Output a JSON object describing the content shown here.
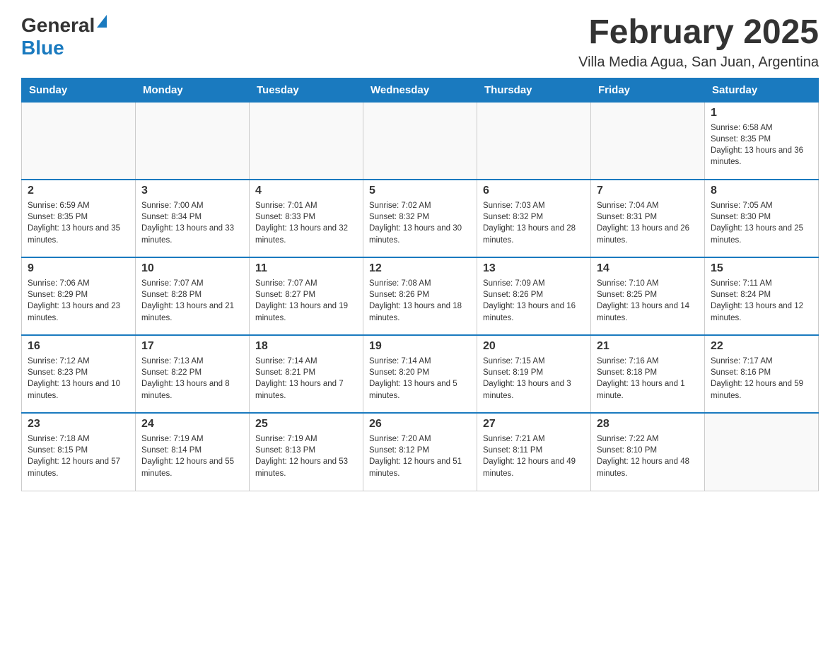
{
  "header": {
    "logo_general": "General",
    "logo_blue": "Blue",
    "month_title": "February 2025",
    "location": "Villa Media Agua, San Juan, Argentina"
  },
  "weekdays": [
    "Sunday",
    "Monday",
    "Tuesday",
    "Wednesday",
    "Thursday",
    "Friday",
    "Saturday"
  ],
  "weeks": [
    [
      {
        "day": "",
        "sunrise": "",
        "sunset": "",
        "daylight": ""
      },
      {
        "day": "",
        "sunrise": "",
        "sunset": "",
        "daylight": ""
      },
      {
        "day": "",
        "sunrise": "",
        "sunset": "",
        "daylight": ""
      },
      {
        "day": "",
        "sunrise": "",
        "sunset": "",
        "daylight": ""
      },
      {
        "day": "",
        "sunrise": "",
        "sunset": "",
        "daylight": ""
      },
      {
        "day": "",
        "sunrise": "",
        "sunset": "",
        "daylight": ""
      },
      {
        "day": "1",
        "sunrise": "Sunrise: 6:58 AM",
        "sunset": "Sunset: 8:35 PM",
        "daylight": "Daylight: 13 hours and 36 minutes."
      }
    ],
    [
      {
        "day": "2",
        "sunrise": "Sunrise: 6:59 AM",
        "sunset": "Sunset: 8:35 PM",
        "daylight": "Daylight: 13 hours and 35 minutes."
      },
      {
        "day": "3",
        "sunrise": "Sunrise: 7:00 AM",
        "sunset": "Sunset: 8:34 PM",
        "daylight": "Daylight: 13 hours and 33 minutes."
      },
      {
        "day": "4",
        "sunrise": "Sunrise: 7:01 AM",
        "sunset": "Sunset: 8:33 PM",
        "daylight": "Daylight: 13 hours and 32 minutes."
      },
      {
        "day": "5",
        "sunrise": "Sunrise: 7:02 AM",
        "sunset": "Sunset: 8:32 PM",
        "daylight": "Daylight: 13 hours and 30 minutes."
      },
      {
        "day": "6",
        "sunrise": "Sunrise: 7:03 AM",
        "sunset": "Sunset: 8:32 PM",
        "daylight": "Daylight: 13 hours and 28 minutes."
      },
      {
        "day": "7",
        "sunrise": "Sunrise: 7:04 AM",
        "sunset": "Sunset: 8:31 PM",
        "daylight": "Daylight: 13 hours and 26 minutes."
      },
      {
        "day": "8",
        "sunrise": "Sunrise: 7:05 AM",
        "sunset": "Sunset: 8:30 PM",
        "daylight": "Daylight: 13 hours and 25 minutes."
      }
    ],
    [
      {
        "day": "9",
        "sunrise": "Sunrise: 7:06 AM",
        "sunset": "Sunset: 8:29 PM",
        "daylight": "Daylight: 13 hours and 23 minutes."
      },
      {
        "day": "10",
        "sunrise": "Sunrise: 7:07 AM",
        "sunset": "Sunset: 8:28 PM",
        "daylight": "Daylight: 13 hours and 21 minutes."
      },
      {
        "day": "11",
        "sunrise": "Sunrise: 7:07 AM",
        "sunset": "Sunset: 8:27 PM",
        "daylight": "Daylight: 13 hours and 19 minutes."
      },
      {
        "day": "12",
        "sunrise": "Sunrise: 7:08 AM",
        "sunset": "Sunset: 8:26 PM",
        "daylight": "Daylight: 13 hours and 18 minutes."
      },
      {
        "day": "13",
        "sunrise": "Sunrise: 7:09 AM",
        "sunset": "Sunset: 8:26 PM",
        "daylight": "Daylight: 13 hours and 16 minutes."
      },
      {
        "day": "14",
        "sunrise": "Sunrise: 7:10 AM",
        "sunset": "Sunset: 8:25 PM",
        "daylight": "Daylight: 13 hours and 14 minutes."
      },
      {
        "day": "15",
        "sunrise": "Sunrise: 7:11 AM",
        "sunset": "Sunset: 8:24 PM",
        "daylight": "Daylight: 13 hours and 12 minutes."
      }
    ],
    [
      {
        "day": "16",
        "sunrise": "Sunrise: 7:12 AM",
        "sunset": "Sunset: 8:23 PM",
        "daylight": "Daylight: 13 hours and 10 minutes."
      },
      {
        "day": "17",
        "sunrise": "Sunrise: 7:13 AM",
        "sunset": "Sunset: 8:22 PM",
        "daylight": "Daylight: 13 hours and 8 minutes."
      },
      {
        "day": "18",
        "sunrise": "Sunrise: 7:14 AM",
        "sunset": "Sunset: 8:21 PM",
        "daylight": "Daylight: 13 hours and 7 minutes."
      },
      {
        "day": "19",
        "sunrise": "Sunrise: 7:14 AM",
        "sunset": "Sunset: 8:20 PM",
        "daylight": "Daylight: 13 hours and 5 minutes."
      },
      {
        "day": "20",
        "sunrise": "Sunrise: 7:15 AM",
        "sunset": "Sunset: 8:19 PM",
        "daylight": "Daylight: 13 hours and 3 minutes."
      },
      {
        "day": "21",
        "sunrise": "Sunrise: 7:16 AM",
        "sunset": "Sunset: 8:18 PM",
        "daylight": "Daylight: 13 hours and 1 minute."
      },
      {
        "day": "22",
        "sunrise": "Sunrise: 7:17 AM",
        "sunset": "Sunset: 8:16 PM",
        "daylight": "Daylight: 12 hours and 59 minutes."
      }
    ],
    [
      {
        "day": "23",
        "sunrise": "Sunrise: 7:18 AM",
        "sunset": "Sunset: 8:15 PM",
        "daylight": "Daylight: 12 hours and 57 minutes."
      },
      {
        "day": "24",
        "sunrise": "Sunrise: 7:19 AM",
        "sunset": "Sunset: 8:14 PM",
        "daylight": "Daylight: 12 hours and 55 minutes."
      },
      {
        "day": "25",
        "sunrise": "Sunrise: 7:19 AM",
        "sunset": "Sunset: 8:13 PM",
        "daylight": "Daylight: 12 hours and 53 minutes."
      },
      {
        "day": "26",
        "sunrise": "Sunrise: 7:20 AM",
        "sunset": "Sunset: 8:12 PM",
        "daylight": "Daylight: 12 hours and 51 minutes."
      },
      {
        "day": "27",
        "sunrise": "Sunrise: 7:21 AM",
        "sunset": "Sunset: 8:11 PM",
        "daylight": "Daylight: 12 hours and 49 minutes."
      },
      {
        "day": "28",
        "sunrise": "Sunrise: 7:22 AM",
        "sunset": "Sunset: 8:10 PM",
        "daylight": "Daylight: 12 hours and 48 minutes."
      },
      {
        "day": "",
        "sunrise": "",
        "sunset": "",
        "daylight": ""
      }
    ]
  ]
}
